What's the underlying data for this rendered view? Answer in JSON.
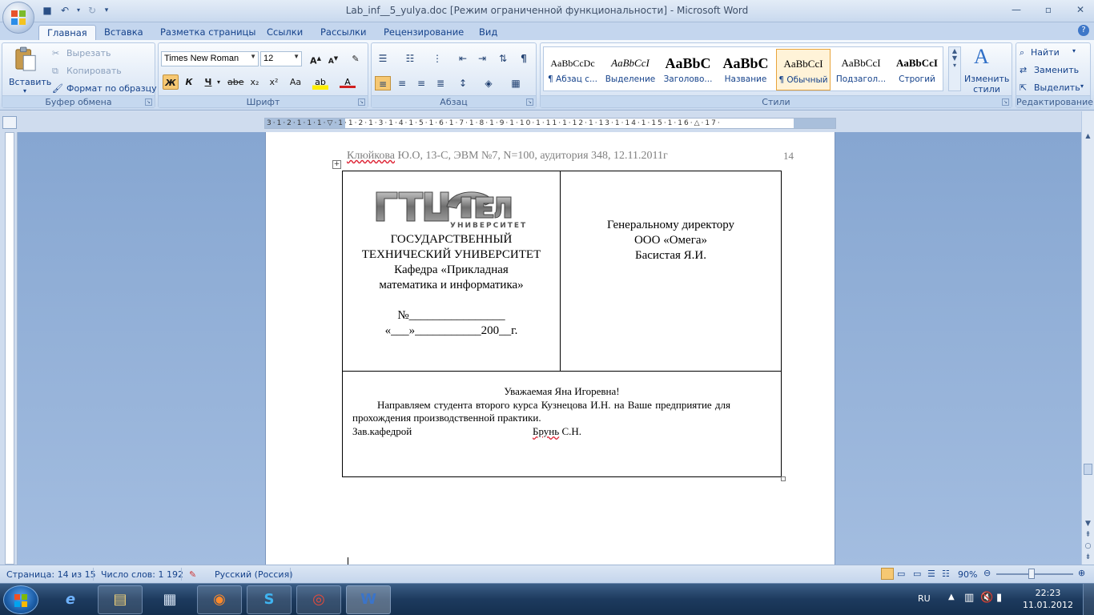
{
  "window": {
    "title": "Lab_inf__5_yulya.doc [Режим ограниченной функциональности] - Microsoft Word"
  },
  "tabs": [
    "Главная",
    "Вставка",
    "Разметка страницы",
    "Ссылки",
    "Рассылки",
    "Рецензирование",
    "Вид"
  ],
  "ribbon": {
    "clipboard": {
      "paste": "Вставить",
      "cut": "Вырезать",
      "copy": "Копировать",
      "format_painter": "Формат по образцу",
      "label": "Буфер обмена"
    },
    "font": {
      "name": "Times New Roman",
      "size": "12",
      "label": "Шрифт",
      "bold": "Ж",
      "italic": "К",
      "underline": "Ч",
      "strike": "abe",
      "sub": "x₂",
      "sup": "x²",
      "case": "Aa"
    },
    "paragraph": {
      "label": "Абзац"
    },
    "styles": {
      "label": "Стили",
      "items": [
        {
          "preview": "AaBbCcDc",
          "name": "¶ Абзац с..."
        },
        {
          "preview": "AaBbCcI",
          "name": "Выделение"
        },
        {
          "preview": "AaBbC",
          "name": "Заголово..."
        },
        {
          "preview": "AaBbC",
          "name": "Название"
        },
        {
          "preview": "AaBbCcI",
          "name": "¶ Обычный"
        },
        {
          "preview": "AaBbCcI",
          "name": "Подзагол..."
        },
        {
          "preview": "AaBbCcI",
          "name": "Строгий"
        }
      ],
      "change": "Изменить стили"
    },
    "editing": {
      "label": "Редактирование",
      "find": "Найти",
      "replace": "Заменить",
      "select": "Выделить"
    }
  },
  "document": {
    "header_author": "Клюйкова",
    "header_rest": " Ю.О, 13-С, ЭВМ №7, N=100, аудитория 348, 12.11.2011г",
    "page_number": "14",
    "logo_text": "ГТУ ОРЕЛ",
    "logo_sub": "УНИВЕРСИТЕТ",
    "left_lines": [
      "ГОСУДАРСТВЕННЫЙ",
      "ТЕХНИЧЕСКИЙ УНИВЕРСИТЕТ",
      "Кафедра «Прикладная",
      "математика и информатика»"
    ],
    "number_line": "№________________",
    "date_line": "«___»___________200__г.",
    "right_lines": [
      "Генеральному директору",
      "ООО «Омега»",
      "Басистая Я.И."
    ],
    "greeting": "Уважаемая Яна Игоревна!",
    "body_line1": "Направляем студента второго курса Кузнецова И.Н. на Ваше предприятие для",
    "body_line2": "прохождения производственной практики.",
    "sign_left": "Зав.кафедрой",
    "sign_surname": "Брунь",
    "sign_initials": " С.Н."
  },
  "statusbar": {
    "page": "Страница: 14 из 15",
    "words": "Число слов: 1 192",
    "language": "Русский (Россия)",
    "zoom": "90%"
  },
  "taskbar": {
    "lang": "RU",
    "time": "22:23",
    "date": "11.01.2012"
  },
  "colors": {
    "accent": "#15428b",
    "ribbon_bg": "#dbe7f5",
    "doc_bg": "#8baad3"
  }
}
